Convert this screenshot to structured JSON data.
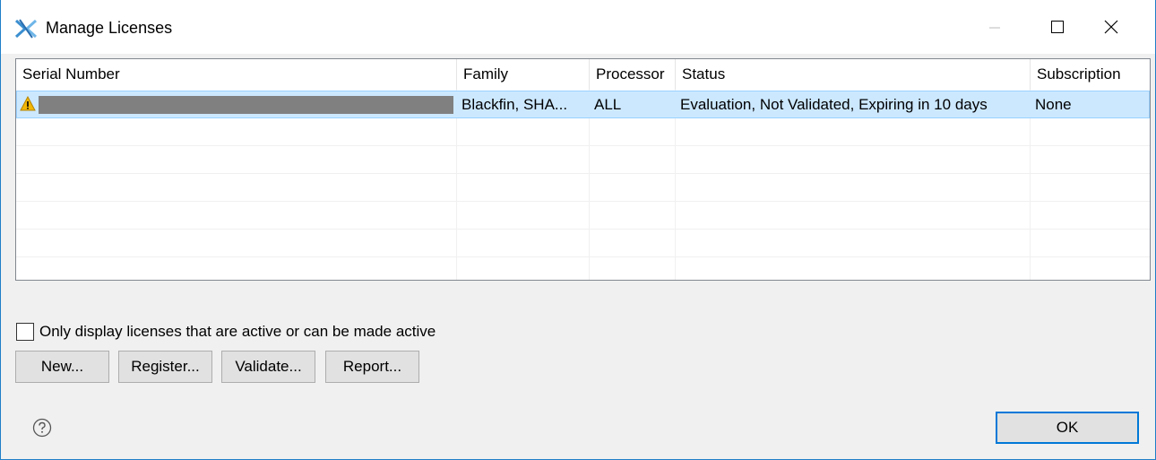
{
  "window": {
    "title": "Manage Licenses"
  },
  "table": {
    "columns": [
      "Serial Number",
      "Family",
      "Processor",
      "Status",
      "Subscription"
    ],
    "rows": [
      {
        "serial": "",
        "family": "Blackfin, SHA...",
        "processor": "ALL",
        "status": "Evaluation, Not Validated, Expiring in 10 days",
        "subscription": "None",
        "selected": true,
        "icon": "warning-icon"
      }
    ]
  },
  "filter": {
    "checkbox_label": "Only display licenses that are active or can be made active",
    "checked": false
  },
  "buttons": {
    "new": "New...",
    "register": "Register...",
    "validate": "Validate...",
    "report": "Report...",
    "ok": "OK"
  },
  "colors": {
    "selection": "#cce8ff",
    "selection_border": "#99d1ff",
    "accent": "#0078d7",
    "warning": "#f2b705"
  }
}
